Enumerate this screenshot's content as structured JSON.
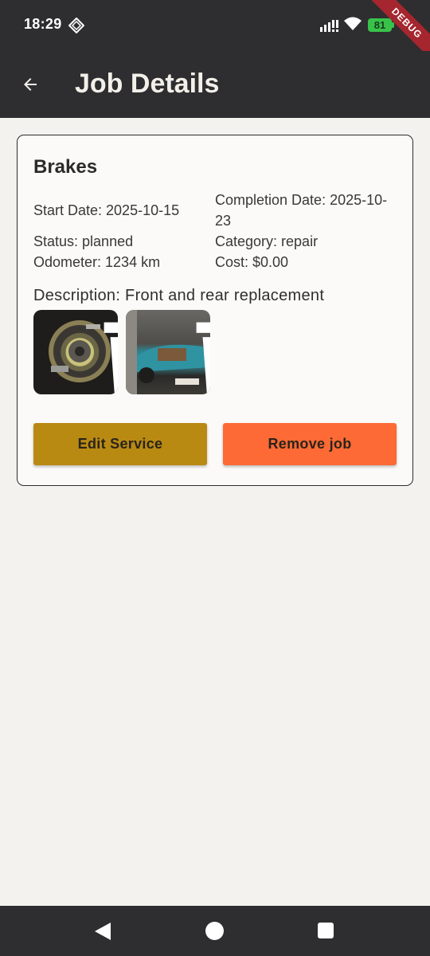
{
  "status_bar": {
    "time": "18:29",
    "battery": "81",
    "debug_label": "DEBUG"
  },
  "app_bar": {
    "title": "Job Details",
    "back_icon": "arrow-back-icon"
  },
  "job": {
    "title": "Brakes",
    "start_date": "Start Date: 2025-10-15",
    "completion_date": "Completion Date: 2025-10-23",
    "status": "Status: planned",
    "category": "Category: repair",
    "odometer": "Odometer: 1234 km",
    "cost": "Cost: $0.00",
    "description": "Description: Front and rear replacement",
    "photos": [
      {
        "subject": "brake drum assembly",
        "action_icon": "trash-icon"
      },
      {
        "subject": "blue car in garage",
        "action_icon": "trash-icon"
      }
    ]
  },
  "actions": {
    "edit_label": "Edit Service",
    "remove_label": "Remove job"
  },
  "colors": {
    "app_bar": "#2e2d2f",
    "background": "#f4f2ef",
    "edit_button": "#b98a12",
    "remove_button": "#fe6a35",
    "battery": "#38c24a"
  },
  "nav_bar": {
    "icons": [
      "nav-back-icon",
      "nav-home-icon",
      "nav-recents-icon"
    ]
  }
}
